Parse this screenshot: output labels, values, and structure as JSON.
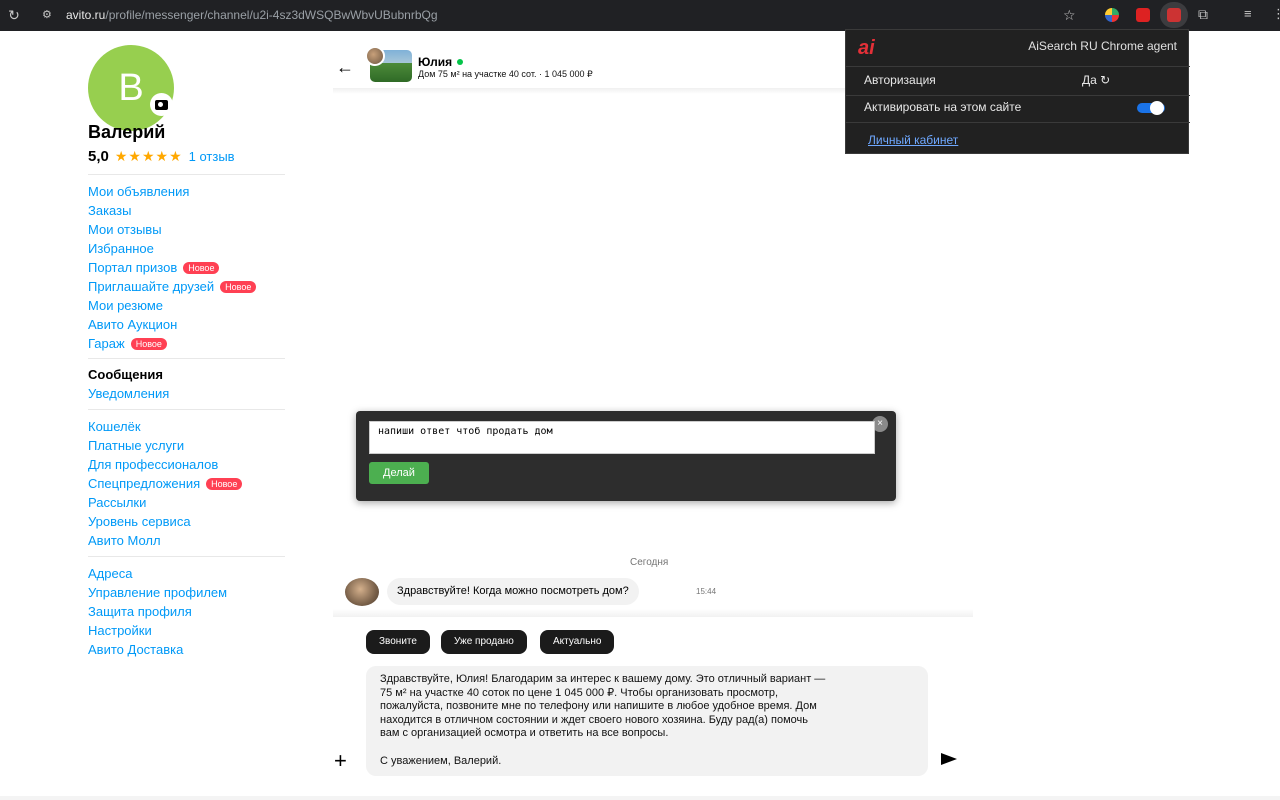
{
  "browser": {
    "url_host": "avito.ru",
    "url_path": "/profile/messenger/channel/u2i-4sz3dWSQBwWbvUBubnrbQg",
    "icons": [
      "reload-icon",
      "site-info-icon",
      "star-icon",
      "extensions-icon"
    ]
  },
  "profile": {
    "avatar_letter": "В",
    "name": "Валерий",
    "rating": "5,0",
    "stars": "★★★★★",
    "reviews": "1 отзыв"
  },
  "sidebar": {
    "group1": [
      {
        "label": "Мои объявления"
      },
      {
        "label": "Заказы"
      },
      {
        "label": "Мои отзывы"
      },
      {
        "label": "Избранное"
      },
      {
        "label": "Портал призов",
        "badge": "Новое"
      },
      {
        "label": "Приглашайте друзей",
        "badge": "Новое"
      },
      {
        "label": "Мои резюме"
      },
      {
        "label": "Авито Аукцион"
      },
      {
        "label": "Гараж",
        "badge": "Новое"
      }
    ],
    "group2": [
      {
        "label": "Сообщения"
      },
      {
        "label": "Уведомления"
      }
    ],
    "group3": [
      {
        "label": "Кошелёк"
      },
      {
        "label": "Платные услуги"
      },
      {
        "label": "Для профессионалов"
      },
      {
        "label": "Спецпредложения",
        "badge": "Новое"
      },
      {
        "label": "Рассылки"
      },
      {
        "label": "Уровень сервиса"
      },
      {
        "label": "Авито Молл"
      }
    ],
    "group4": [
      {
        "label": "Адреса"
      },
      {
        "label": "Управление профилем"
      },
      {
        "label": "Защита профиля"
      },
      {
        "label": "Настройки"
      },
      {
        "label": "Авито Доставка"
      }
    ]
  },
  "chat": {
    "contact_name": "Юлия",
    "listing": "Дом 75 м² на участке 40 сот. · 1 045 000 ₽",
    "day_label": "Сегодня",
    "incoming_message": "Здравствуйте! Когда можно посмотреть дом?",
    "incoming_time": "15:44",
    "quick_replies": [
      "Звоните",
      "Уже продано",
      "Актуально"
    ],
    "draft": {
      "lines": [
        "Здравствуйте, Юлия! Благодарим за интерес к вашему дому. Это отличный вариант —",
        "75 м² на участке 40 соток по цене 1 045 000 ₽. Чтобы организовать просмотр,",
        "пожалуйста, позвоните мне по телефону или напишите в любое удобное время. Дом",
        "находится в отличном состоянии и ждет своего нового хозяина. Буду рад(а) помочь",
        "вам с организацией осмотра и ответить на все вопросы."
      ],
      "signature": "С уважением, Валерий."
    }
  },
  "extension": {
    "logo": "ai",
    "title": "AiSearch RU Chrome agent",
    "auth_label": "Авторизация",
    "auth_value": "Да ↻",
    "activate_label": "Активировать на этом сайте",
    "activate_on": true,
    "cabinet_link": "Личный кабинет"
  },
  "ai_prompt": {
    "value": "напиши ответ чтоб продать дом",
    "button": "Делай",
    "close": "×"
  },
  "colors": {
    "link": "#0099f7",
    "badge": "#ff4053",
    "star": "#ffa800",
    "avatar": "#97cf4f",
    "online": "#04c449",
    "ai_button": "#4caf50",
    "toggle": "#1a73e8"
  }
}
